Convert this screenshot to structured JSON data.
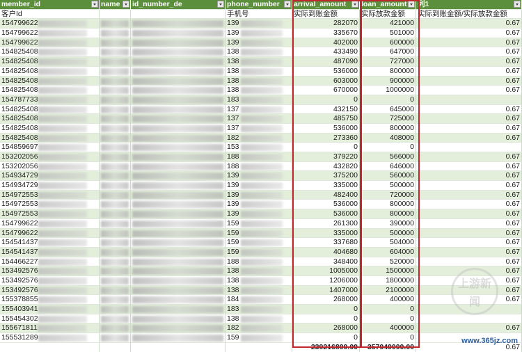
{
  "columns": [
    "member_id",
    "name",
    "id_number_de",
    "phone_number",
    "arrival_amount",
    "loan_amount",
    "列1"
  ],
  "subheaders": [
    "客户Id",
    "",
    "",
    "手机号",
    "实际到账金额",
    "实际放款金额",
    "实际到账金额/实际放款金额"
  ],
  "rows": [
    [
      "154799622",
      "139",
      "282070",
      "421000",
      "0.67"
    ],
    [
      "154799622",
      "139",
      "335670",
      "501000",
      "0.67"
    ],
    [
      "154799622",
      "139",
      "402000",
      "600000",
      "0.67"
    ],
    [
      "154825408",
      "138",
      "433490",
      "647000",
      "0.67"
    ],
    [
      "154825408",
      "138",
      "487090",
      "727000",
      "0.67"
    ],
    [
      "154825408",
      "138",
      "536000",
      "800000",
      "0.67"
    ],
    [
      "154825408",
      "138",
      "603000",
      "900000",
      "0.67"
    ],
    [
      "154825408",
      "138",
      "670000",
      "1000000",
      "0.67"
    ],
    [
      "154787733",
      "183",
      "0",
      "0",
      ""
    ],
    [
      "154825408",
      "137",
      "432150",
      "645000",
      "0.67"
    ],
    [
      "154825408",
      "137",
      "485750",
      "725000",
      "0.67"
    ],
    [
      "154825408",
      "137",
      "536000",
      "800000",
      "0.67"
    ],
    [
      "154825408",
      "182",
      "273360",
      "408000",
      "0.67"
    ],
    [
      "154859697",
      "153",
      "0",
      "0",
      ""
    ],
    [
      "153202056",
      "188",
      "379220",
      "566000",
      "0.67"
    ],
    [
      "153202056",
      "188",
      "432820",
      "646000",
      "0.67"
    ],
    [
      "154934729",
      "139",
      "375200",
      "560000",
      "0.67"
    ],
    [
      "154934729",
      "139",
      "335000",
      "500000",
      "0.67"
    ],
    [
      "154972553",
      "139",
      "482400",
      "720000",
      "0.67"
    ],
    [
      "154972553",
      "139",
      "536000",
      "800000",
      "0.67"
    ],
    [
      "154972553",
      "139",
      "536000",
      "800000",
      "0.67"
    ],
    [
      "154799622",
      "159",
      "261300",
      "390000",
      "0.67"
    ],
    [
      "154799622",
      "159",
      "335000",
      "500000",
      "0.67"
    ],
    [
      "154541437",
      "159",
      "337680",
      "504000",
      "0.67"
    ],
    [
      "154541437",
      "159",
      "404680",
      "604000",
      "0.67"
    ],
    [
      "154466227",
      "188",
      "348400",
      "520000",
      "0.67"
    ],
    [
      "153492576",
      "138",
      "1005000",
      "1500000",
      "0.67"
    ],
    [
      "153492576",
      "138",
      "1206000",
      "1800000",
      "0.67"
    ],
    [
      "153492576",
      "138",
      "1407000",
      "2100000",
      "0.67"
    ],
    [
      "155378855",
      "184",
      "268000",
      "400000",
      "0.67"
    ],
    [
      "155403941",
      "183",
      "0",
      "0",
      ""
    ],
    [
      "155454302",
      "138",
      "0",
      "0",
      ""
    ],
    [
      "155671811",
      "182",
      "268000",
      "400000",
      "0.67"
    ],
    [
      "155531289",
      "159",
      "0",
      "0",
      ""
    ]
  ],
  "totals": {
    "arrival": "239216800.00",
    "loan": "357040000.00",
    "ratio": "0.67"
  },
  "watermark": {
    "site": "www.365jz.com",
    "seal": "上游新闻"
  },
  "colors": {
    "header": "#5b8f3c",
    "band": "#e3efda",
    "highlight": "#c0262e"
  }
}
